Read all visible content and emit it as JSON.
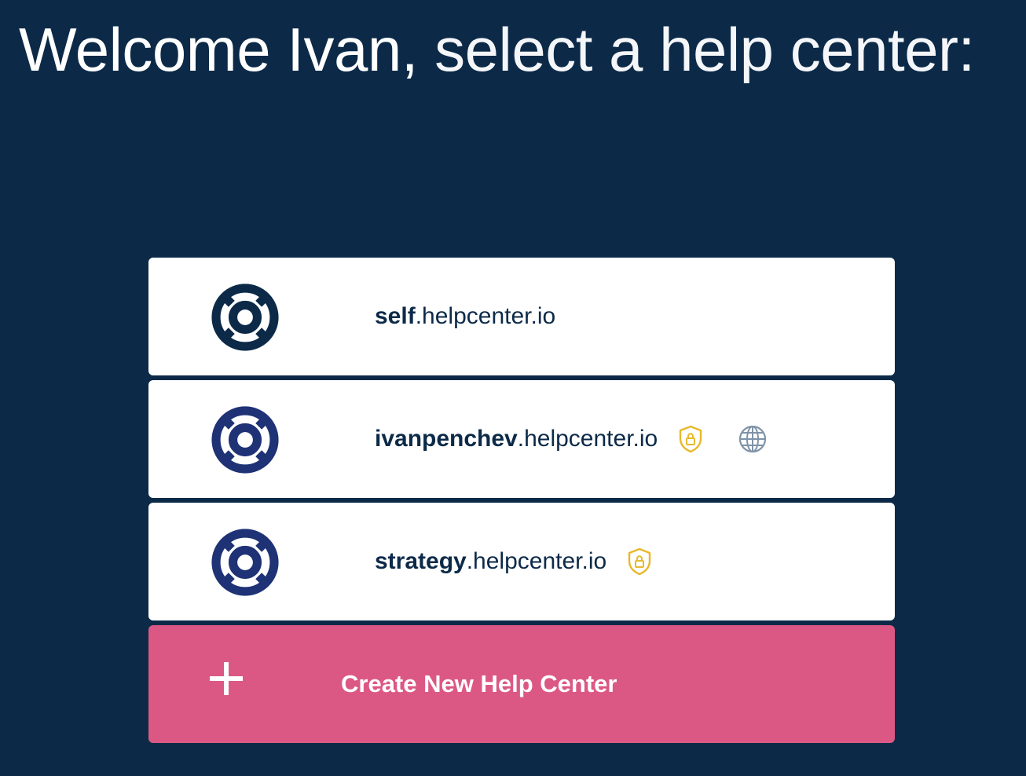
{
  "header": {
    "greeting": "Welcome Ivan,",
    "prompt": " select a help center:"
  },
  "colors": {
    "background": "#0c2a48",
    "card": "#ffffff",
    "logo_dark": "#0c2a48",
    "logo_blue": "#1e3275",
    "create_button": "#dc5884",
    "shield": "#e8b82a",
    "globe": "#7f93a8"
  },
  "help_centers": [
    {
      "subdomain": "self",
      "suffix": ".helpcenter.io",
      "icon": "lifebuoy-icon",
      "badges": []
    },
    {
      "subdomain": "ivanpenchev",
      "suffix": ".helpcenter.io",
      "icon": "lifebuoy-icon",
      "badges": [
        "shield-lock-icon",
        "globe-icon"
      ]
    },
    {
      "subdomain": "strategy",
      "suffix": ".helpcenter.io",
      "icon": "lifebuoy-icon",
      "badges": [
        "shield-lock-icon"
      ]
    }
  ],
  "create": {
    "label": "Create New Help Center",
    "icon": "plus-icon"
  }
}
